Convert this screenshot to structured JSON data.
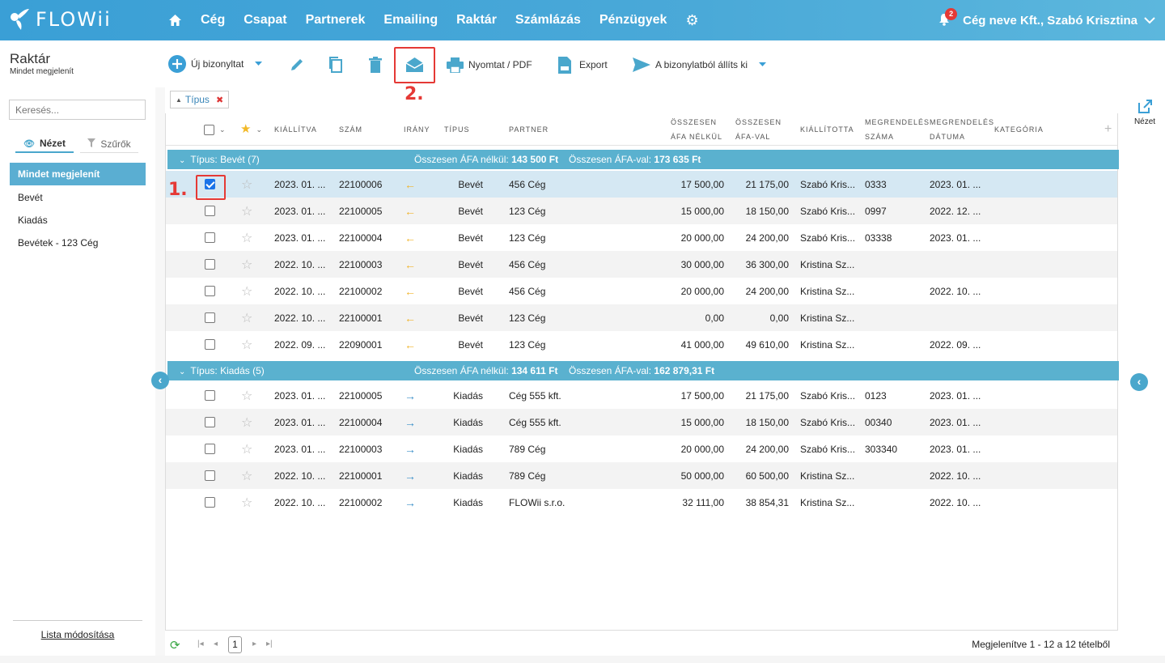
{
  "brand": {
    "name": "FLOWii"
  },
  "nav": {
    "items": [
      "Cég",
      "Csapat",
      "Partnerek",
      "Emailing",
      "Raktár",
      "Számlázás",
      "Pénzügyek"
    ],
    "notification_count": "2",
    "user_label": "Cég neve Kft., Szabó Krisztina"
  },
  "sidebar": {
    "title": "Raktár",
    "subtitle": "Mindet megjelenít",
    "search_placeholder": "Keresés...",
    "tab_view": "Nézet",
    "tab_filters": "Szűrők",
    "items": [
      "Mindet megjelenít",
      "Bevét",
      "Kiadás",
      "Bevétek - 123 Cég"
    ],
    "footer_link": "Lista módosítása"
  },
  "toolbar": {
    "new_doc": "Új bizonyltat",
    "print": "Nyomtat / PDF",
    "export": "Export",
    "issue_from": "A bizonylatból állíts ki"
  },
  "annotations": {
    "step1": "1.",
    "step2": "2."
  },
  "filter_chip": {
    "label": "Típus"
  },
  "columns": {
    "issued": "KIÁLLÍTVA",
    "number": "SZÁM",
    "direction": "IRÁNY",
    "type": "TÍPUS",
    "partner": "PARTNER",
    "net_1": "ÖSSZESEN",
    "net_2": "ÁFA NÉLKÜL",
    "gross_1": "ÖSSZESEN",
    "gross_2": "ÁFA-VAL",
    "issued_by": "KIÁLLÍTOTTA",
    "order_no_1": "MEGRENDELÉS",
    "order_no_2": "SZÁMA",
    "order_date_1": "MEGRENDELÉS",
    "order_date_2": "DÁTUMA",
    "category": "KATEGÓRIA"
  },
  "groups": [
    {
      "title": "Típus: Bevét (7)",
      "net_label": "Összesen ÁFA nélkül:",
      "net_value": "143 500 Ft",
      "gross_label": "Összesen ÁFA-val:",
      "gross_value": "173 635 Ft",
      "rows": [
        {
          "issued": "2023. 01. ...",
          "number": "22100006",
          "dir": "in",
          "type": "Bevét",
          "partner": "456 Cég",
          "net": "17 500,00",
          "gross": "21 175,00",
          "by": "Szabó Kris...",
          "order_no": "0333",
          "order_date": "2023. 01. ...",
          "checked": true
        },
        {
          "issued": "2023. 01. ...",
          "number": "22100005",
          "dir": "in",
          "type": "Bevét",
          "partner": "123 Cég",
          "net": "15 000,00",
          "gross": "18 150,00",
          "by": "Szabó Kris...",
          "order_no": "0997",
          "order_date": "2022. 12. ...",
          "checked": false
        },
        {
          "issued": "2023. 01. ...",
          "number": "22100004",
          "dir": "in",
          "type": "Bevét",
          "partner": "123 Cég",
          "net": "20 000,00",
          "gross": "24 200,00",
          "by": "Szabó Kris...",
          "order_no": "03338",
          "order_date": "2023. 01. ...",
          "checked": false
        },
        {
          "issued": "2022. 10. ...",
          "number": "22100003",
          "dir": "in",
          "type": "Bevét",
          "partner": "456 Cég",
          "net": "30 000,00",
          "gross": "36 300,00",
          "by": "Kristina Sz...",
          "order_no": "",
          "order_date": "",
          "checked": false
        },
        {
          "issued": "2022. 10. ...",
          "number": "22100002",
          "dir": "in",
          "type": "Bevét",
          "partner": "456 Cég",
          "net": "20 000,00",
          "gross": "24 200,00",
          "by": "Kristina Sz...",
          "order_no": "",
          "order_date": "2022. 10. ...",
          "checked": false
        },
        {
          "issued": "2022. 10. ...",
          "number": "22100001",
          "dir": "in",
          "type": "Bevét",
          "partner": "123 Cég",
          "net": "0,00",
          "gross": "0,00",
          "by": "Kristina Sz...",
          "order_no": "",
          "order_date": "",
          "checked": false
        },
        {
          "issued": "2022. 09. ...",
          "number": "22090001",
          "dir": "in",
          "type": "Bevét",
          "partner": "123 Cég",
          "net": "41 000,00",
          "gross": "49 610,00",
          "by": "Kristina Sz...",
          "order_no": "",
          "order_date": "2022. 09. ...",
          "checked": false
        }
      ]
    },
    {
      "title": "Típus: Kiadás (5)",
      "net_label": "Összesen ÁFA nélkül:",
      "net_value": "134 611 Ft",
      "gross_label": "Összesen ÁFA-val:",
      "gross_value": "162 879,31 Ft",
      "rows": [
        {
          "issued": "2023. 01. ...",
          "number": "22100005",
          "dir": "out",
          "type": "Kiadás",
          "partner": "Cég 555 kft.",
          "net": "17 500,00",
          "gross": "21 175,00",
          "by": "Szabó Kris...",
          "order_no": "0123",
          "order_date": "2023. 01. ...",
          "checked": false
        },
        {
          "issued": "2023. 01. ...",
          "number": "22100004",
          "dir": "out",
          "type": "Kiadás",
          "partner": "Cég 555 kft.",
          "net": "15 000,00",
          "gross": "18 150,00",
          "by": "Szabó Kris...",
          "order_no": "00340",
          "order_date": "2023. 01. ...",
          "checked": false
        },
        {
          "issued": "2023. 01. ...",
          "number": "22100003",
          "dir": "out",
          "type": "Kiadás",
          "partner": "789 Cég",
          "net": "20 000,00",
          "gross": "24 200,00",
          "by": "Szabó Kris...",
          "order_no": "303340",
          "order_date": "2023. 01. ...",
          "checked": false
        },
        {
          "issued": "2022. 10. ...",
          "number": "22100001",
          "dir": "out",
          "type": "Kiadás",
          "partner": "789 Cég",
          "net": "50 000,00",
          "gross": "60 500,00",
          "by": "Kristina Sz...",
          "order_no": "",
          "order_date": "2022. 10. ...",
          "checked": false
        },
        {
          "issued": "2022. 10. ...",
          "number": "22100002",
          "dir": "out",
          "type": "Kiadás",
          "partner": "FLOWii s.r.o.",
          "net": "32 111,00",
          "gross": "38 854,31",
          "by": "Kristina Sz...",
          "order_no": "",
          "order_date": "2022. 10. ...",
          "checked": false
        }
      ]
    }
  ],
  "pager": {
    "current_page": "1",
    "info": "Megjelenítve 1 - 12 a 12 tételből"
  },
  "right_panel": {
    "view_label": "Nézet"
  }
}
